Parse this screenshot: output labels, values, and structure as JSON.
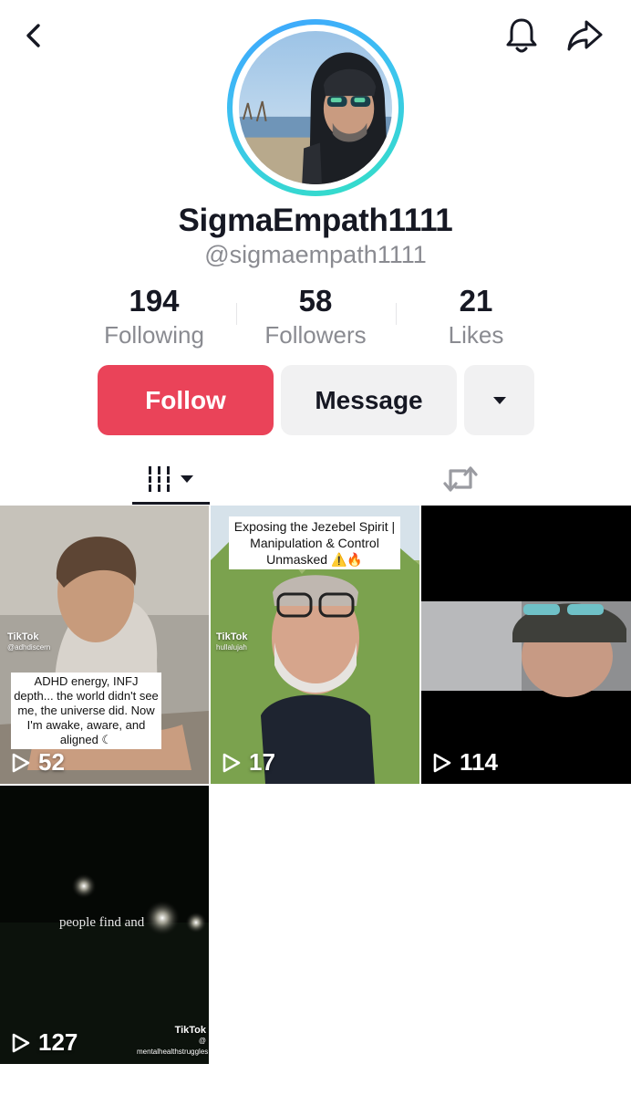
{
  "profile": {
    "display_name": "SigmaEmpath1111",
    "handle": "@sigmaempath1111"
  },
  "stats": [
    {
      "value": "194",
      "label": "Following"
    },
    {
      "value": "58",
      "label": "Followers"
    },
    {
      "value": "21",
      "label": "Likes"
    }
  ],
  "actions": {
    "follow_label": "Follow",
    "message_label": "Message",
    "more_icon": "caret-down-icon"
  },
  "header_icons": [
    "back-chevron-icon",
    "bell-icon",
    "share-arrow-icon"
  ],
  "tabs": [
    {
      "icon": "videos-grid-icon",
      "selected": true
    },
    {
      "icon": "repost-icon",
      "selected": false
    }
  ],
  "videos": [
    {
      "views": "52",
      "watermark": "TikTok",
      "watermark_user": "@adhdiscern",
      "caption": "ADHD energy, INFJ depth... the world didn't see me, the universe did. Now I'm awake, aware, and aligned ☾"
    },
    {
      "views": "17",
      "watermark": "TikTok",
      "watermark_user": "hullalujah",
      "caption": "Exposing the Jezebel Spirit | Manipulation & Control Unmasked ⚠️🔥"
    },
    {
      "views": "114"
    },
    {
      "views": "127",
      "overlay_text": "people find and",
      "watermark": "TikTok",
      "watermark_user": "@ mentalhealthstruggles"
    }
  ],
  "colors": {
    "follow_button": "#ea4359",
    "secondary_button": "#f1f1f2",
    "muted_text": "#8a8b91",
    "primary_text": "#161823",
    "avatar_ring_start": "#3fa3ff",
    "avatar_ring_end": "#33e0c4"
  }
}
